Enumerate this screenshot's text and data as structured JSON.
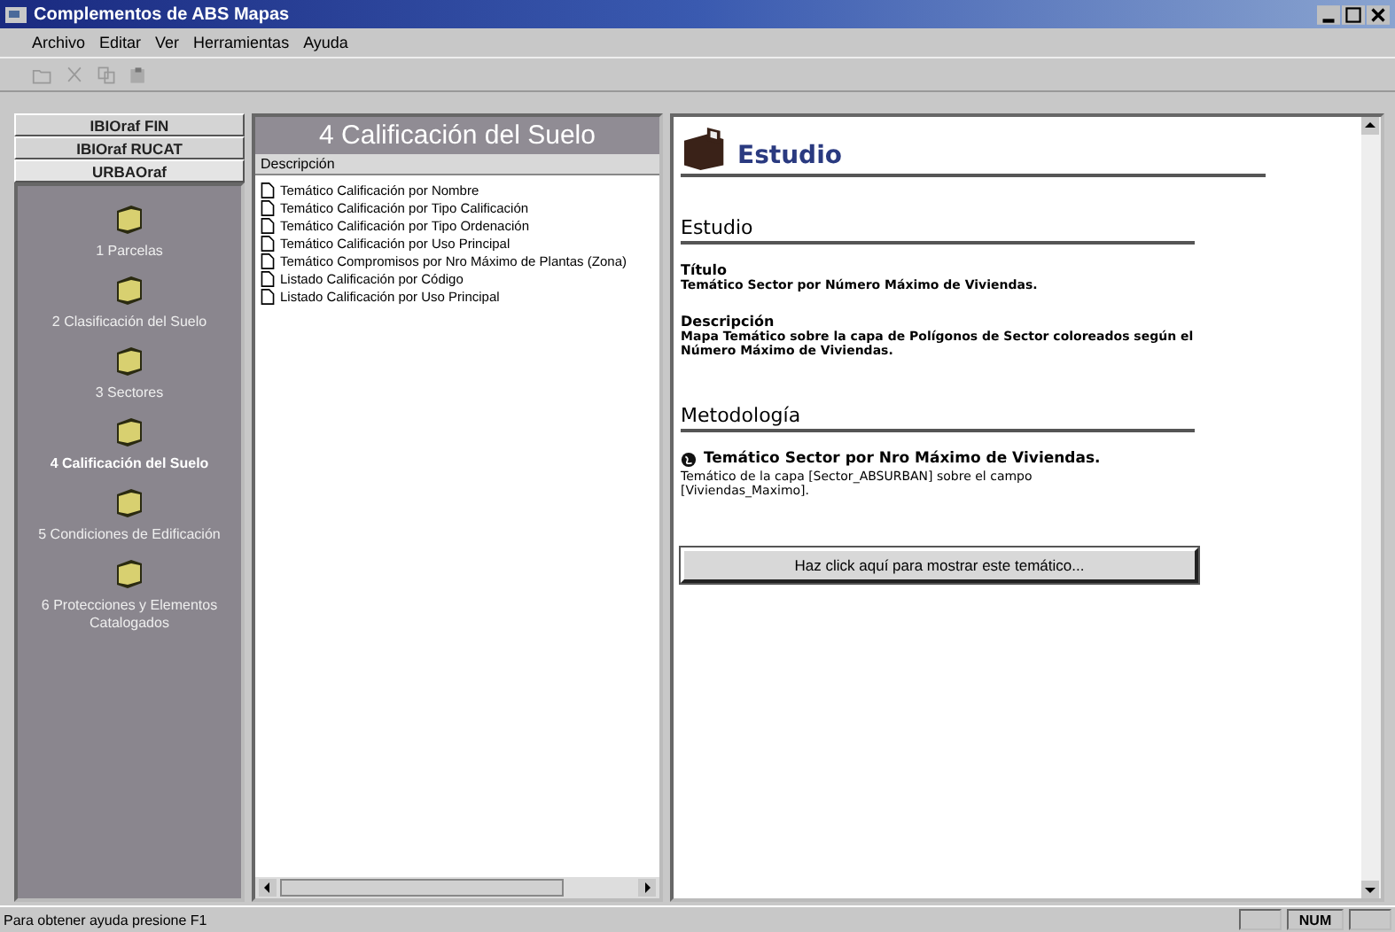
{
  "window": {
    "title": "Complementos de ABS Mapas"
  },
  "menu": [
    "Archivo",
    "Editar",
    "Ver",
    "Herramientas",
    "Ayuda"
  ],
  "sidebar": {
    "buttons": [
      {
        "label": "IBIOraf FIN",
        "selected": false
      },
      {
        "label": "IBIOraf RUCAT",
        "selected": false
      },
      {
        "label": "URBAOraf",
        "selected": true
      }
    ],
    "items": [
      {
        "label": "1 Parcelas",
        "selected": false
      },
      {
        "label": "2 Clasificación del Suelo",
        "selected": false
      },
      {
        "label": "3 Sectores",
        "selected": false
      },
      {
        "label": "4 Calificación del Suelo",
        "selected": true
      },
      {
        "label": "5 Condiciones de Edificación",
        "selected": false
      },
      {
        "label": "6 Protecciones y Elementos Catalogados",
        "selected": false
      }
    ]
  },
  "list_panel": {
    "title": "4 Calificación del Suelo",
    "column": "Descripción",
    "items": [
      "Temático Calificación por Nombre",
      "Temático Calificación por Tipo Calificación",
      "Temático Calificación por Tipo Ordenación",
      "Temático Calificación por Uso Principal",
      "Temático Compromisos por Nro Máximo de Plantas (Zona)",
      "Listado Calificación por Código",
      "Listado Calificación por Uso Principal"
    ]
  },
  "detail": {
    "header": "Estudio",
    "section_1": "Estudio",
    "fields": [
      {
        "label": "Título",
        "value": "Temático Sector por Número Máximo de Viviendas."
      },
      {
        "label": "Descripción",
        "value": "Mapa Temático sobre la capa de Polígonos de Sector coloreados según el Número Máximo de Viviendas."
      }
    ],
    "section_2": "Metodología",
    "method_title": "Temático Sector por Nro Máximo de Viviendas.",
    "method_text": "Temático de la capa [Sector_ABSURBAN] sobre el campo [Viviendas_Maximo].",
    "button": "Haz click aquí para mostrar este temático..."
  },
  "status_bar": {
    "text": "Para obtener ayuda presione F1",
    "indicator": "NUM"
  }
}
